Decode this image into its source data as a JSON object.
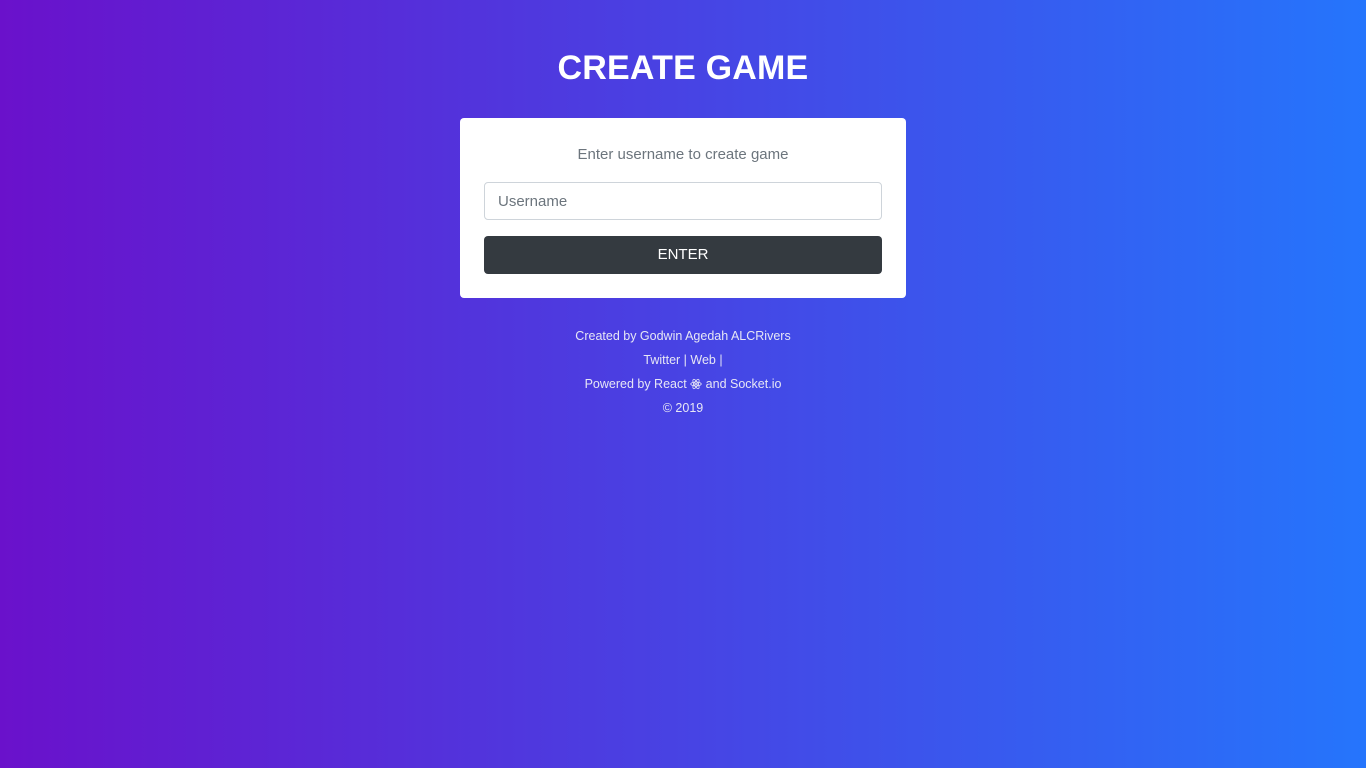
{
  "page": {
    "title": "CREATE GAME"
  },
  "card": {
    "subtitle": "Enter username to create game",
    "username_placeholder": "Username",
    "username_value": "",
    "enter_label": "ENTER"
  },
  "footer": {
    "credit_prefix": "Created by ",
    "author": "Godwin Agedah ALCRivers",
    "twitter_label": "Twitter",
    "web_label": "Web",
    "separator": "|",
    "powered_prefix": "Powered by ",
    "react_label": "React",
    "react_icon": "react-atom-icon",
    "and_text": "and",
    "socket_label": "Socket.io",
    "copyright": "© 2019"
  },
  "colors": {
    "gradient_start": "#6a11cb",
    "gradient_end": "#2575fc",
    "card_background": "#ffffff",
    "button_background": "#343a40",
    "subtitle_text": "#6c757d"
  }
}
